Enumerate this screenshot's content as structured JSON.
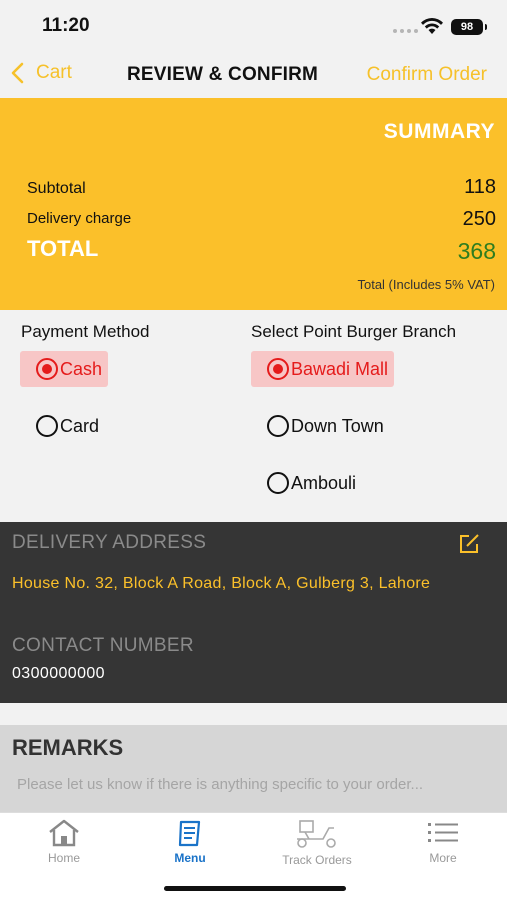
{
  "status_bar": {
    "time": "11:20",
    "battery": "98"
  },
  "nav": {
    "back_label": "Cart",
    "title": "REVIEW & CONFIRM",
    "confirm_label": "Confirm Order"
  },
  "summary": {
    "title": "SUMMARY",
    "subtotal_label": "Subtotal",
    "subtotal_value": "118",
    "delivery_label": "Delivery charge",
    "delivery_value": "250",
    "total_label": "TOTAL",
    "total_value": "368",
    "vat_note": "Total (Includes 5% VAT)"
  },
  "payment": {
    "heading": "Payment Method",
    "options": [
      {
        "label": "Cash",
        "selected": true
      },
      {
        "label": "Card",
        "selected": false
      }
    ]
  },
  "branch": {
    "heading": "Select Point Burger Branch",
    "options": [
      {
        "label": "Bawadi Mall",
        "selected": true
      },
      {
        "label": "Down Town",
        "selected": false
      },
      {
        "label": "Ambouli",
        "selected": false
      }
    ]
  },
  "delivery": {
    "heading": "DELIVERY ADDRESS",
    "address": "House No. 32, Block A Road, Block A, Gulberg 3, Lahore",
    "contact_heading": "CONTACT NUMBER",
    "contact_number": "0300000000"
  },
  "remarks": {
    "title": "REMARKS",
    "placeholder": "Please let us know if there is anything specific to your order..."
  },
  "tabs": [
    {
      "label": "Home",
      "icon": "home-icon",
      "active": false
    },
    {
      "label": "Menu",
      "icon": "menu-icon",
      "active": true
    },
    {
      "label": "Track Orders",
      "icon": "delivery-scooter-icon",
      "active": false
    },
    {
      "label": "More",
      "icon": "more-list-icon",
      "active": false
    }
  ],
  "colors": {
    "accent": "#fbc02a",
    "selected_red": "#e51b1b",
    "selected_bg": "#f7c6c6",
    "total_green": "#2e7d1f",
    "dark_panel": "#353535",
    "tab_active": "#1a73c8"
  }
}
